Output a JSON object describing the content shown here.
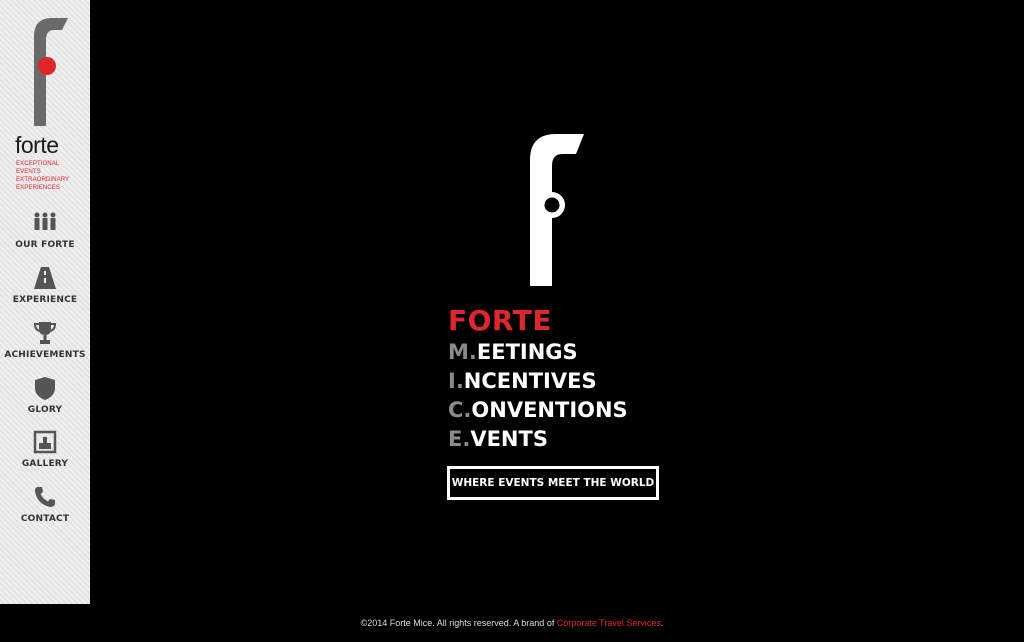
{
  "sidebar": {
    "brand": "forte",
    "tagline": [
      "EXCEPTIONAL",
      "EVENTS",
      "EXTRAORDINARY",
      "EXPERIENCES"
    ],
    "nav": [
      {
        "label": "OUR FORTE",
        "icon": "people-icon"
      },
      {
        "label": "EXPERIENCE",
        "icon": "road-icon"
      },
      {
        "label": "ACHIEVEMENTS",
        "icon": "trophy-icon"
      },
      {
        "label": "GLORY",
        "icon": "shield-icon"
      },
      {
        "label": "GALLERY",
        "icon": "gallery-icon"
      },
      {
        "label": "CONTACT",
        "icon": "phone-icon"
      }
    ]
  },
  "main": {
    "title": "FORTE",
    "mice": [
      {
        "initial": "M.",
        "rest": "EETINGS"
      },
      {
        "initial": "I.",
        "rest": "NCENTIVES"
      },
      {
        "initial": "C.",
        "rest": "ONVENTIONS"
      },
      {
        "initial": "E.",
        "rest": "VENTS"
      }
    ],
    "tagline_button": "WHERE EVENTS MEET THE WORLD"
  },
  "footer": {
    "text": "©2014 Forte Mice. All rights reserved. A brand of ",
    "link": "Corporate Travel Services",
    "end": "."
  },
  "colors": {
    "accent": "#e0262d",
    "background": "#000000",
    "sidebar": "#e8e8e8"
  }
}
